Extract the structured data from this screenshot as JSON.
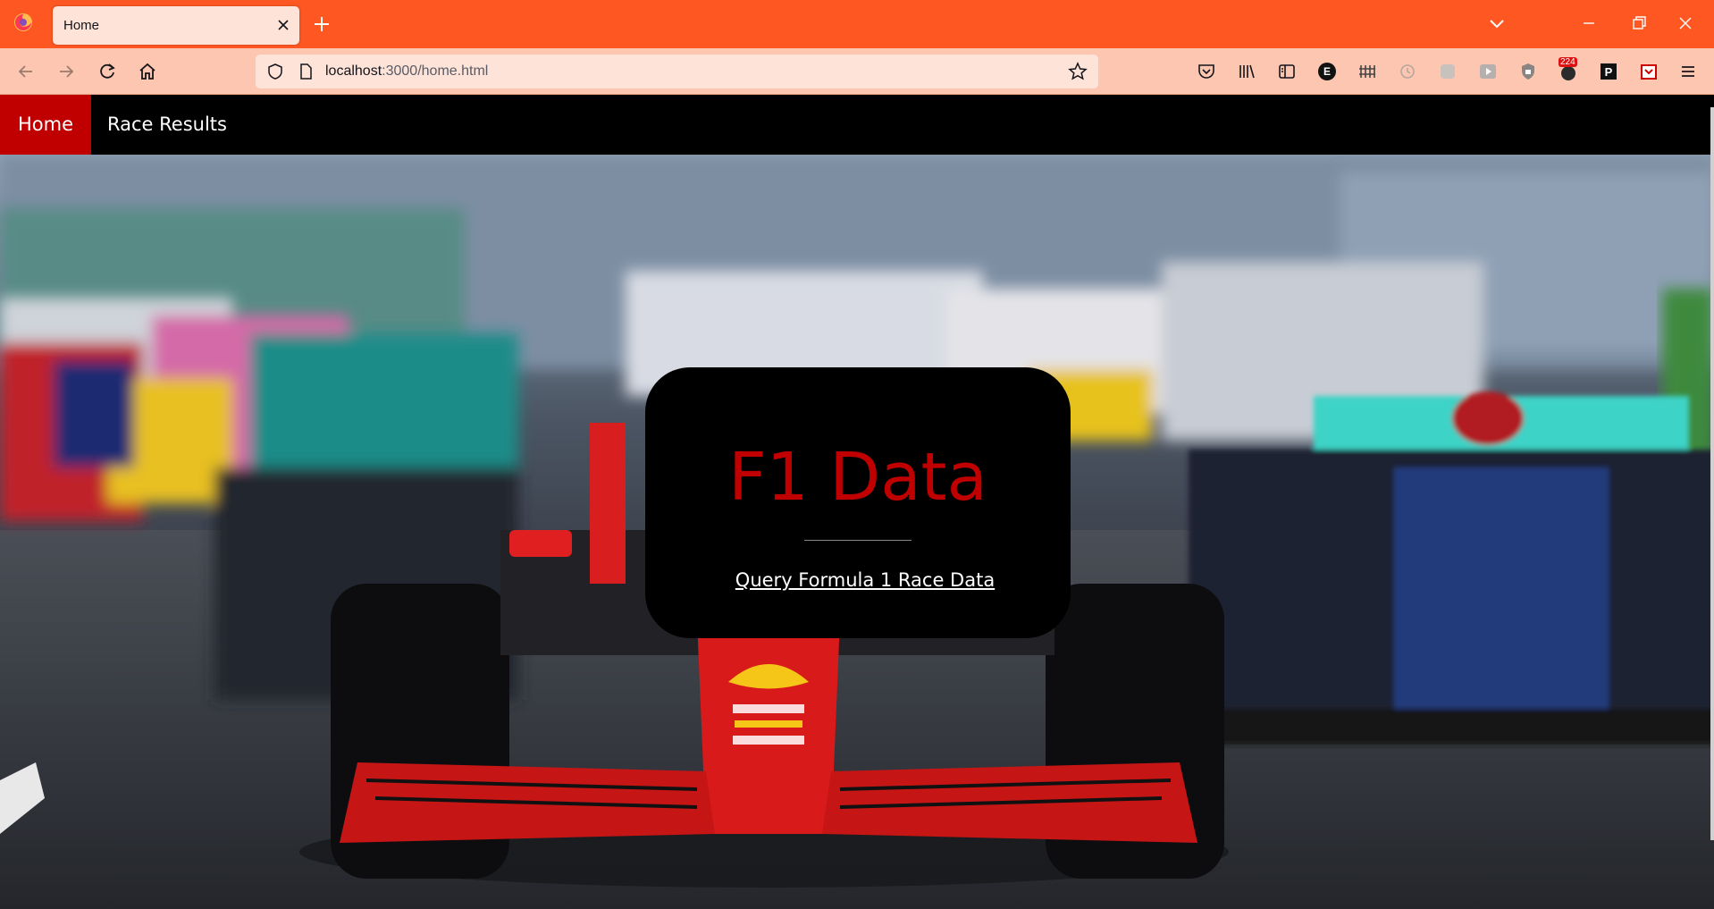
{
  "browser": {
    "tab_title": "Home",
    "url_host": "localhost",
    "url_path": ":3000/home.html",
    "badge_count": "224",
    "extension_letter_e": "E",
    "extension_letter_p": "P",
    "accent_color": "#ff5722"
  },
  "site": {
    "nav": {
      "home_label": "Home",
      "race_results_label": "Race Results"
    },
    "hero": {
      "title": "F1 Data",
      "link_label": "Query Formula 1 Race Data"
    },
    "brand_red": "#c00000"
  },
  "icons": {
    "toolbar": [
      "back-icon",
      "forward-icon",
      "reload-icon",
      "home-icon",
      "pocket-icon",
      "library-icon",
      "sidebar-icon",
      "extension-e-icon",
      "extension-grid-icon",
      "history-icon",
      "extension-icon",
      "video-icon",
      "shield-icon",
      "badge-extension-icon",
      "extension-p-icon",
      "extension-box-icon",
      "menu-icon"
    ]
  }
}
